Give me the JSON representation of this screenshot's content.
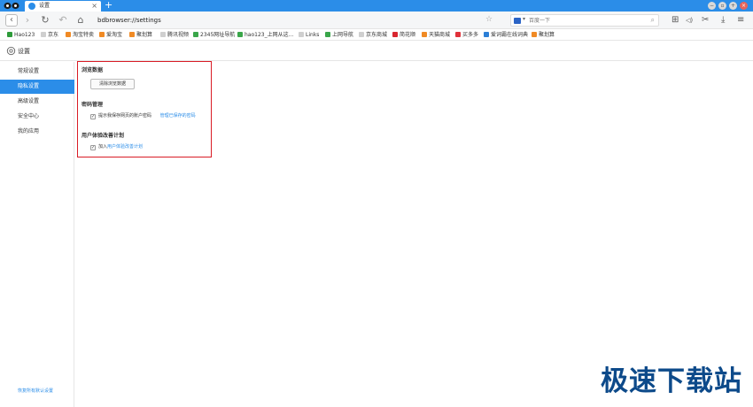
{
  "tab": {
    "title": "设置",
    "close": "×",
    "new_tab": "+"
  },
  "window_controls": {
    "minimize": "−",
    "restore": "▫",
    "maximize": "+",
    "close": "×"
  },
  "nav": {
    "back": "‹",
    "forward": "›",
    "reload": "↻",
    "undo": "↶",
    "home": "⌂",
    "url": "bdbrowser://settings",
    "star": "☆",
    "search_placeholder": "百度一下",
    "search_caret": "▾",
    "search_glass": "⌕",
    "tools": {
      "apps": "⊞",
      "sound": "◁)",
      "cut": "✂",
      "download": "⤓",
      "menu": "≡"
    }
  },
  "bookmarks": [
    {
      "label": "Hao123",
      "color": "#2e9b3a"
    },
    {
      "label": "京东",
      "color": "#cfcfcf"
    },
    {
      "label": "淘宝特卖",
      "color": "#f08a24"
    },
    {
      "label": "爱淘宝",
      "color": "#f08a24"
    },
    {
      "label": "聚划算",
      "color": "#f08a24"
    },
    {
      "label": "腾讯视频",
      "color": "#cfcfcf"
    },
    {
      "label": "2345网址导航",
      "color": "#3aa64a"
    },
    {
      "label": "hao123_上网从这...",
      "color": "#3aa64a"
    },
    {
      "label": "Links",
      "color": "#cfcfcf"
    },
    {
      "label": "上网导航",
      "color": "#3aa64a"
    },
    {
      "label": "京东商城",
      "color": "#cfcfcf"
    },
    {
      "label": "简花顺",
      "color": "#d8262f"
    },
    {
      "label": "天猫商城",
      "color": "#f08a24"
    },
    {
      "label": "买多多",
      "color": "#e0323a"
    },
    {
      "label": "爱词霸在线词典",
      "color": "#2c7fd6"
    },
    {
      "label": "聚划算",
      "color": "#f08a24"
    }
  ],
  "page": {
    "title": "设置"
  },
  "sidebar": {
    "items": [
      {
        "label": "常规设置",
        "active": false
      },
      {
        "label": "隐私设置",
        "active": true
      },
      {
        "label": "高级设置",
        "active": false
      },
      {
        "label": "安全中心",
        "active": false
      },
      {
        "label": "我的应用",
        "active": false
      }
    ],
    "restore_defaults": "恢复所有默认设置"
  },
  "sections": {
    "browsing_data": {
      "title": "浏览数据",
      "button": "清除浏览数据"
    },
    "password": {
      "title": "密码管理",
      "checkbox_label": "提示我保存网页的账户密码",
      "checked": true,
      "manage_link": "管理已保存的密码"
    },
    "ux_plan": {
      "title": "用户体验改善计划",
      "checkbox_prefix": "加入",
      "checkbox_link": "用户体验改善计划",
      "checked": true
    }
  },
  "checkmark": "✓",
  "watermark": "极速下载站",
  "colors": {
    "accent": "#2b8de8",
    "highlight_box": "#d91c25",
    "watermark": "#0d4a8a"
  }
}
